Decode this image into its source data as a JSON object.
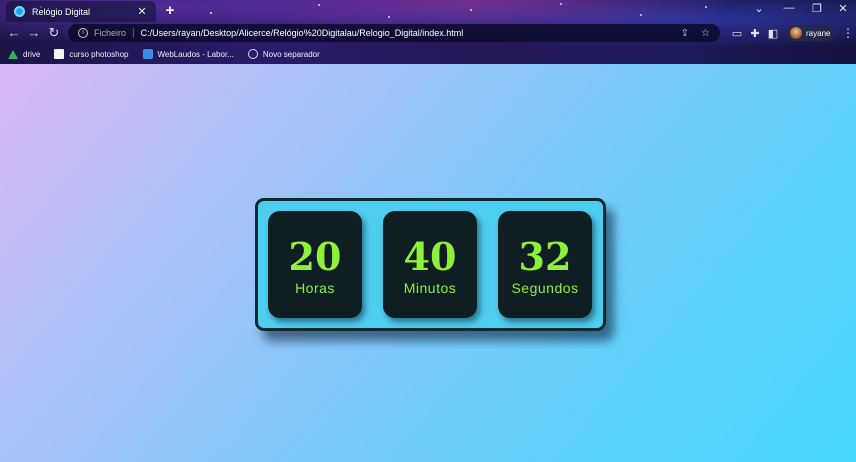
{
  "browser": {
    "tab": {
      "title": "Relógio Digital",
      "close": "✕"
    },
    "new_tab": "+",
    "window_controls": {
      "collapse": "⌄",
      "minimize": "—",
      "restore": "❐",
      "close": "✕"
    },
    "nav": {
      "back": "←",
      "forward": "→",
      "reload": "↻"
    },
    "address": {
      "info_icon": "i",
      "scheme_label": "Ficheiro",
      "separator": "|",
      "url": "C:/Users/rayan/Desktop/Alicerce/Relógio%20Digitalau/Relogio_Digital/index.html",
      "share_icon": "⇪",
      "star_icon": "☆"
    },
    "extensions": {
      "cast_icon": "▭",
      "puzzle_icon": "✚",
      "sidepanel_icon": "◧"
    },
    "profile": {
      "name": "rayane"
    },
    "menu": "⋮",
    "bookmarks": [
      {
        "label": "drive",
        "icon": "drive-icon"
      },
      {
        "label": "curso photoshop",
        "icon": "page-icon"
      },
      {
        "label": "WebLaudos - Labor...",
        "icon": "weblaudos-icon"
      },
      {
        "label": "Novo separador",
        "icon": "globe-icon"
      }
    ]
  },
  "clock": {
    "hours": {
      "value": "20",
      "label": "Horas"
    },
    "minutes": {
      "value": "40",
      "label": "Minutos"
    },
    "seconds": {
      "value": "32",
      "label": "Segundos"
    }
  },
  "colors": {
    "digit": "#8ff03a",
    "card": "#0f1e22",
    "panel": "#4dcdf0",
    "panel_border": "#0d2a30",
    "background_start": "#d9b6f6",
    "background_end": "#44d6fb"
  }
}
